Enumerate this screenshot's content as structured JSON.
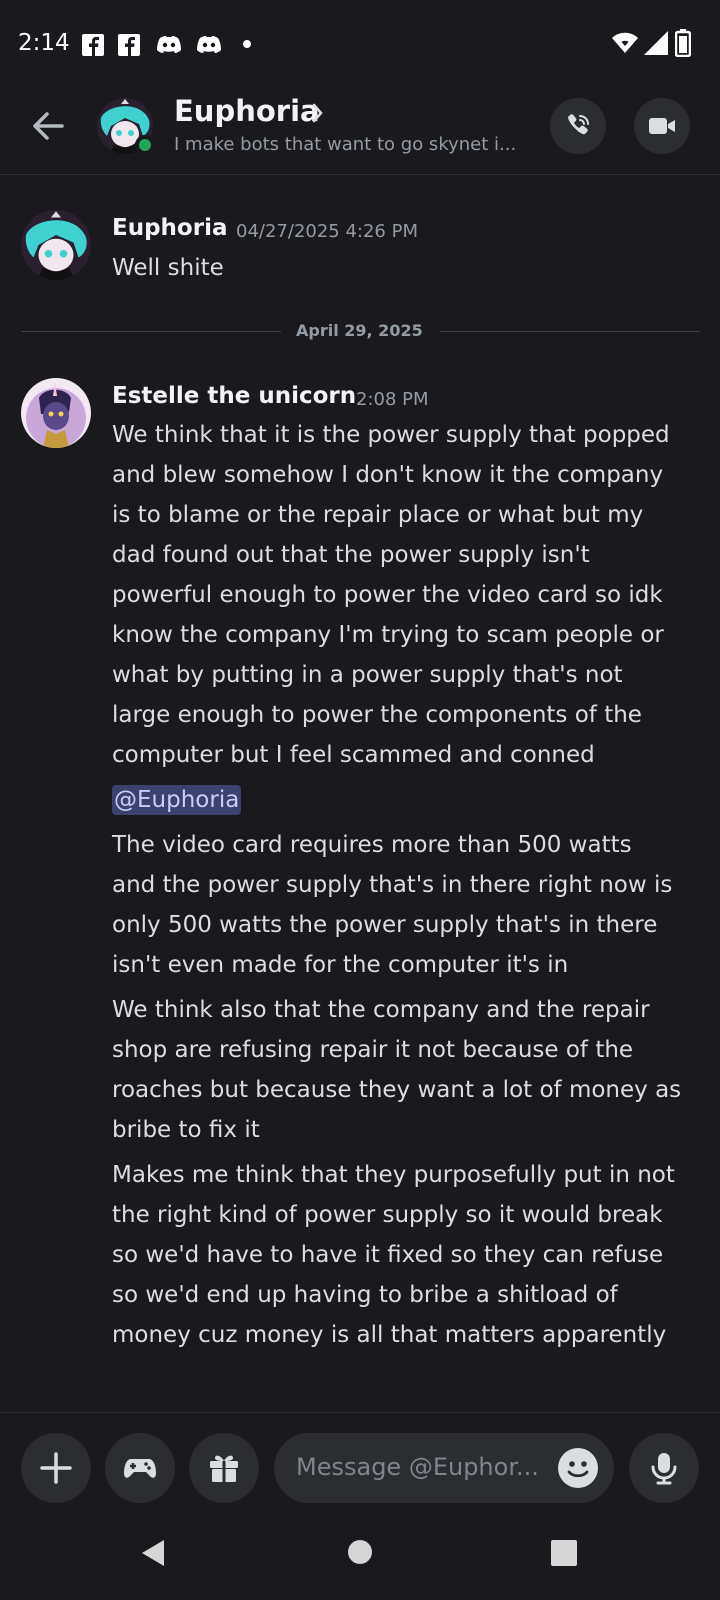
{
  "status_bar": {
    "time": "2:14"
  },
  "header": {
    "name": "Euphoria",
    "subtitle": "I make bots that want to go skynet i..."
  },
  "messages": [
    {
      "author": "Euphoria",
      "timestamp": "04/27/2025 4:26 PM",
      "text": "Well shite"
    }
  ],
  "date_divider": "April 29, 2025",
  "group": {
    "author": "Estelle the unicorn",
    "timestamp": "2:08 PM",
    "p1": [
      "We think that it is the power supply that popped",
      "and blew somehow I don't know it the company",
      "is to blame or the repair place or what but my",
      "dad found out that the power supply isn't",
      "powerful enough to power the video card so idk",
      "know the company I'm trying to scam people or",
      "what by putting in a power supply that's not",
      "large enough to power the components of the",
      "computer but I feel scammed and conned"
    ],
    "mention": "@Euphoria",
    "p2": [
      "The video card requires more than 500 watts",
      "and the power supply that's in there right now is",
      "only 500 watts the power supply that's in there",
      "isn't even made for the computer it's in"
    ],
    "p3": [
      "We think also that the company and the repair",
      "shop are refusing repair it not because of the",
      "roaches but because they want a lot of money as",
      "bribe to fix it"
    ],
    "p4": [
      "Makes me think that they purposefully put in not",
      "the right kind of power supply so it would break",
      "so we'd have to have it fixed so they can refuse",
      "so we'd end up having to bribe a shitload of",
      "money cuz money is all that matters apparently"
    ]
  },
  "composer": {
    "placeholder": "Message @Euphor..."
  },
  "icons": {
    "status": [
      "facebook-icon",
      "facebook-icon",
      "discord-icon",
      "discord-icon",
      "wifi-icon",
      "signal-icon",
      "battery-icon"
    ],
    "header": [
      "back-arrow-icon",
      "chevron-right-icon",
      "phone-call-icon",
      "video-call-icon"
    ],
    "composer": [
      "plus-icon",
      "gamepad-icon",
      "gift-icon",
      "emoji-icon",
      "microphone-icon"
    ],
    "nav": [
      "back-triangle-icon",
      "home-circle-icon",
      "recents-square-icon"
    ]
  },
  "colors": {
    "background": "#1a1a1e",
    "online": "#23a55a",
    "mention_bg": "#3c4270"
  }
}
